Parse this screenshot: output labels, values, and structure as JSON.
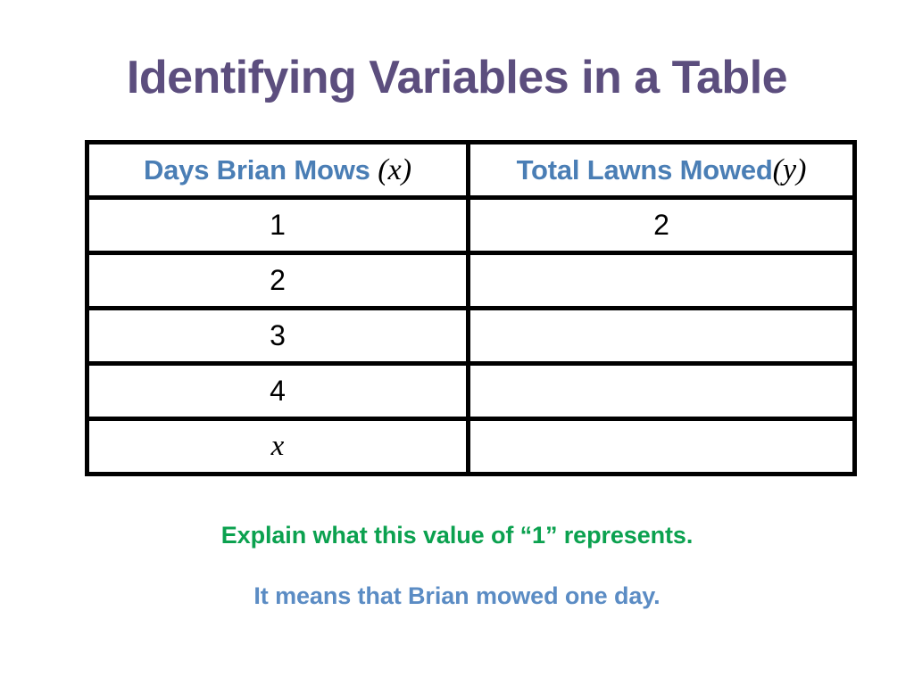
{
  "slide": {
    "title": "Identifying Variables in a Table",
    "title_color": "#5C4E7E",
    "background_color": "#FFFFFF"
  },
  "table": {
    "border_color": "#000000",
    "header_color": "#4A7EB5",
    "columns": [
      {
        "label": "Days Brian Mows",
        "variable": "x"
      },
      {
        "label": "Total Lawns Mowed",
        "variable": "y"
      }
    ],
    "rows": [
      {
        "x": "1",
        "y": "2"
      },
      {
        "x": "2",
        "y": ""
      },
      {
        "x": "3",
        "y": ""
      },
      {
        "x": "4",
        "y": ""
      },
      {
        "x": "x",
        "y": ""
      }
    ]
  },
  "captions": {
    "prompt": "Explain what this value of “1” represents.",
    "prompt_color": "#0BA14F",
    "answer": "It means that Brian mowed one day.",
    "answer_color": "#5B8CC4"
  }
}
